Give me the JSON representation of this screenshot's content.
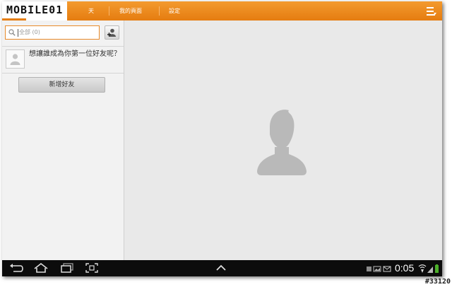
{
  "logo": {
    "text": "MOBILE01"
  },
  "tabs": [
    {
      "label": "天"
    },
    {
      "label": "我的頁面"
    },
    {
      "label": "設定"
    }
  ],
  "search": {
    "placeholder": "全部 (0)"
  },
  "suggestion": {
    "text": "想讓誰成為你第一位好友呢？"
  },
  "add_friend_button": {
    "label": "新增好友"
  },
  "status_bar": {
    "time": "0:05"
  },
  "watermark": {
    "text": "#33120"
  },
  "colors": {
    "accent": "#ee8a1e",
    "navbar": "#0c0c0c"
  }
}
